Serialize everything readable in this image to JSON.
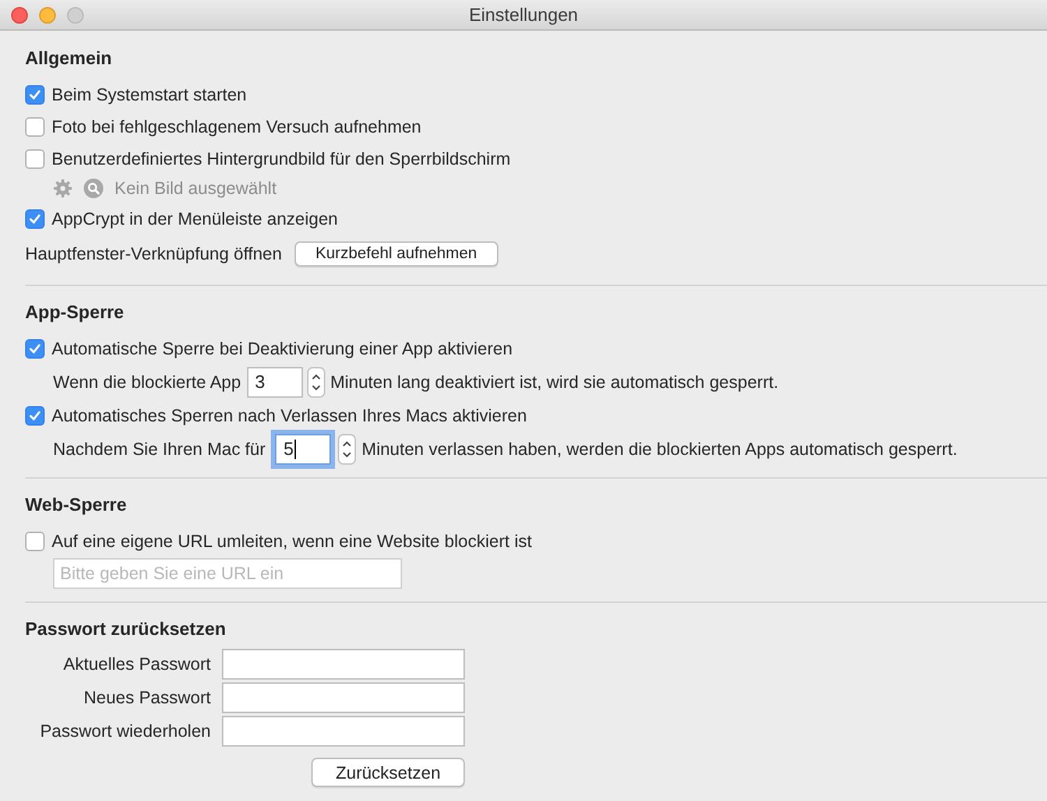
{
  "window": {
    "title": "Einstellungen"
  },
  "sections": [
    {
      "heading": "Allgemein",
      "rows": [
        {
          "kind": "checkbox",
          "label": "Beim Systemstart starten",
          "checked": true
        },
        {
          "kind": "checkbox",
          "label": "Foto bei fehlgeschlagenem Versuch aufnehmen",
          "checked": false
        },
        {
          "kind": "checkbox",
          "label": "Benutzerdefiniertes Hintergrundbild für den Sperrbildschirm",
          "checked": false
        },
        {
          "kind": "image_status",
          "text": "Kein Bild ausgewählt"
        },
        {
          "kind": "checkbox",
          "label": "AppCrypt in der Menüleiste anzeigen",
          "checked": true
        },
        {
          "kind": "shortcut",
          "label": "Hauptfenster-Verknüpfung öffnen",
          "button": "Kurzbefehl aufnehmen"
        }
      ]
    },
    {
      "heading": "App-Sperre",
      "rows": [
        {
          "kind": "checkbox",
          "label": "Automatische Sperre bei Deaktivierung einer App aktivieren",
          "checked": true
        },
        {
          "kind": "stepper",
          "prefix": "Wenn die blockierte App",
          "value": "3",
          "suffix": "Minuten lang deaktiviert ist, wird sie automatisch gesperrt.",
          "focused": false
        },
        {
          "kind": "checkbox",
          "label": "Automatisches Sperren nach Verlassen Ihres Macs aktivieren",
          "checked": true
        },
        {
          "kind": "stepper",
          "prefix": "Nachdem Sie Ihren Mac für",
          "value": "5",
          "suffix": "Minuten verlassen haben, werden die blockierten Apps automatisch gesperrt.",
          "focused": true
        }
      ]
    },
    {
      "heading": "Web-Sperre",
      "rows": [
        {
          "kind": "checkbox",
          "label": "Auf eine eigene URL umleiten, wenn eine Website blockiert ist",
          "checked": false
        },
        {
          "kind": "text_field",
          "placeholder": "Bitte geben Sie eine URL ein"
        }
      ]
    },
    {
      "heading": "Passwort zurücksetzen",
      "rows": [
        {
          "kind": "password",
          "label": "Aktuelles Passwort"
        },
        {
          "kind": "password",
          "label": "Neues Passwort"
        },
        {
          "kind": "password",
          "label": "Passwort wiederholen"
        },
        {
          "kind": "button",
          "label": "Zurücksetzen"
        }
      ]
    }
  ]
}
